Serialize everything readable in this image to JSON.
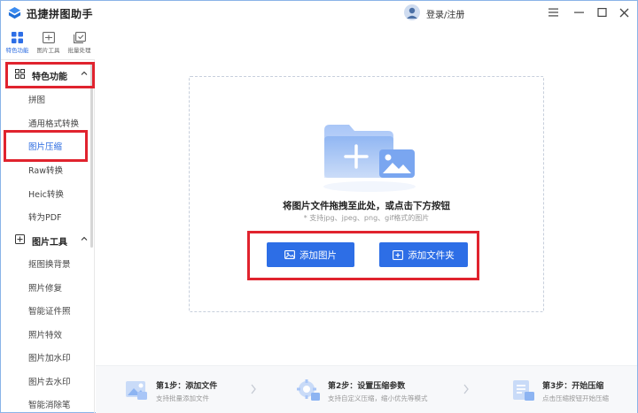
{
  "app": {
    "title": "迅捷拼图助手",
    "login": "登录/注册"
  },
  "tooltabs": [
    {
      "label": "特色功能",
      "icon": "grid-apps-icon",
      "active": true
    },
    {
      "label": "图片工具",
      "icon": "image-tool-icon",
      "active": false
    },
    {
      "label": "批量处理",
      "icon": "batch-icon",
      "active": false
    }
  ],
  "sidebar": {
    "section1": {
      "label": "特色功能",
      "expanded": true
    },
    "section1_items": [
      "拼图",
      "通用格式转换",
      "图片压缩",
      "Raw转换",
      "Heic转换",
      "转为PDF"
    ],
    "section2": {
      "label": "图片工具",
      "expanded": true
    },
    "section2_items": [
      "抠图换背景",
      "照片修复",
      "智能证件照",
      "照片特效",
      "图片加水印",
      "图片去水印",
      "智能消除笔"
    ],
    "active_item": "图片压缩"
  },
  "dropzone": {
    "title": "将图片文件拖拽至此处，或点击下方按钮",
    "hint": "* 支持jpg、jpeg、png、gif格式的图片",
    "add_image": "添加图片",
    "add_folder": "添加文件夹"
  },
  "steps": [
    {
      "title": "第1步：添加文件",
      "desc": "支持批量添加文件"
    },
    {
      "title": "第2步：设置压缩参数",
      "desc": "支持自定义压缩，缩小优先等模式"
    },
    {
      "title": "第3步：开始压缩",
      "desc": "点击压缩按钮开始压缩"
    }
  ],
  "colors": {
    "accent": "#2d6ee6",
    "annotation": "#e0232e"
  }
}
